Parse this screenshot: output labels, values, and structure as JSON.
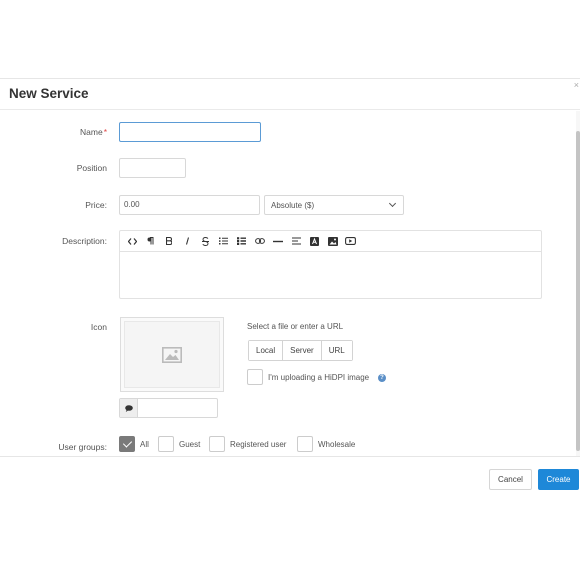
{
  "dialog": {
    "title": "New Service",
    "close_symbol": "×"
  },
  "form": {
    "name_label": "Name",
    "name_required_mark": "*",
    "name_value": "",
    "position_label": "Position",
    "position_value": "",
    "price_label": "Price:",
    "price_value": "0.00",
    "price_type_selected": "Absolute ($)",
    "description_label": "Description:",
    "description_value": "",
    "icon_label": "Icon",
    "icon_hint": "Select a file or enter a URL",
    "icon_sources": [
      "Local",
      "Server",
      "URL"
    ],
    "hidpi_label": "I'm uploading a HiDPI image",
    "hidpi_checked": false,
    "alt_text_value": "",
    "user_groups_label": "User groups:",
    "user_groups": [
      {
        "label": "All",
        "checked": true
      },
      {
        "label": "Guest",
        "checked": false
      },
      {
        "label": "Registered user",
        "checked": false
      },
      {
        "label": "Wholesale",
        "checked": false
      }
    ]
  },
  "toolbar": {
    "buttons": [
      "code-view",
      "paragraph",
      "bold",
      "italic",
      "strikethrough",
      "unordered-list",
      "ordered-list",
      "link",
      "horizontal-rule",
      "align",
      "font-color",
      "image",
      "video"
    ]
  },
  "footer": {
    "cancel_label": "Cancel",
    "create_label": "Create"
  },
  "colors": {
    "primary": "#1e88d8",
    "focus_border": "#5b9bd5",
    "checked_bg": "#7a7a7a",
    "required": "#e04444"
  }
}
